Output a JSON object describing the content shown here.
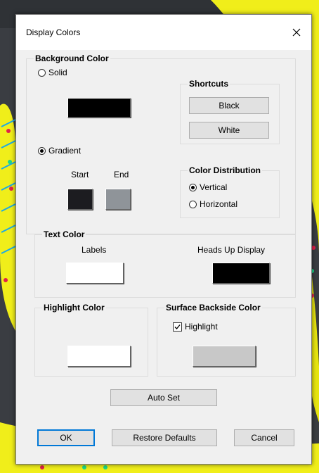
{
  "dialog": {
    "title": "Display Colors",
    "close_glyph": "✕"
  },
  "background_color": {
    "label": "Background Color",
    "solid": {
      "label": "Solid",
      "selected": false,
      "color": "#000000"
    },
    "gradient": {
      "label": "Gradient",
      "selected": true,
      "start_label": "Start",
      "end_label": "End",
      "start_color": "#1c1c20",
      "end_color": "#8f9499"
    },
    "shortcuts": {
      "label": "Shortcuts",
      "black_label": "Black",
      "white_label": "White"
    },
    "color_distribution": {
      "label": "Color Distribution",
      "vertical": {
        "label": "Vertical",
        "selected": true
      },
      "horizontal": {
        "label": "Horizontal",
        "selected": false
      }
    }
  },
  "text_color": {
    "label": "Text Color",
    "labels_label": "Labels",
    "labels_color": "#ffffff",
    "hud_label": "Heads Up Display",
    "hud_color": "#000000"
  },
  "highlight_color": {
    "label": "Highlight Color",
    "color": "#ffffff"
  },
  "surface_backside_color": {
    "label": "Surface Backside Color",
    "highlight_label": "Highlight",
    "highlight_checked": true,
    "color": "#c8c8c8"
  },
  "buttons": {
    "auto_set": "Auto Set",
    "ok": "OK",
    "restore_defaults": "Restore Defaults",
    "cancel": "Cancel"
  },
  "icons": {
    "close": "close-icon",
    "check": "checkmark-icon"
  },
  "colors": {
    "viewport_bg": "#3c3f44",
    "model_yellow": "#f0ee1a",
    "accent_blue": "#0078d7"
  }
}
